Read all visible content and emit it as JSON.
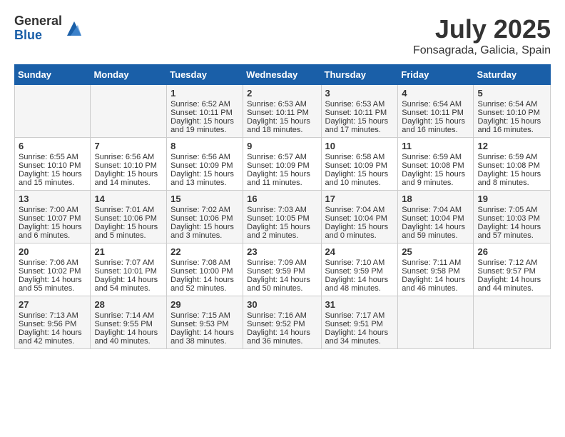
{
  "header": {
    "logo_general": "General",
    "logo_blue": "Blue",
    "month_title": "July 2025",
    "location": "Fonsagrada, Galicia, Spain"
  },
  "weekdays": [
    "Sunday",
    "Monday",
    "Tuesday",
    "Wednesday",
    "Thursday",
    "Friday",
    "Saturday"
  ],
  "weeks": [
    [
      {
        "day": "",
        "info": ""
      },
      {
        "day": "",
        "info": ""
      },
      {
        "day": "1",
        "info": "Sunrise: 6:52 AM\nSunset: 10:11 PM\nDaylight: 15 hours and 19 minutes."
      },
      {
        "day": "2",
        "info": "Sunrise: 6:53 AM\nSunset: 10:11 PM\nDaylight: 15 hours and 18 minutes."
      },
      {
        "day": "3",
        "info": "Sunrise: 6:53 AM\nSunset: 10:11 PM\nDaylight: 15 hours and 17 minutes."
      },
      {
        "day": "4",
        "info": "Sunrise: 6:54 AM\nSunset: 10:11 PM\nDaylight: 15 hours and 16 minutes."
      },
      {
        "day": "5",
        "info": "Sunrise: 6:54 AM\nSunset: 10:10 PM\nDaylight: 15 hours and 16 minutes."
      }
    ],
    [
      {
        "day": "6",
        "info": "Sunrise: 6:55 AM\nSunset: 10:10 PM\nDaylight: 15 hours and 15 minutes."
      },
      {
        "day": "7",
        "info": "Sunrise: 6:56 AM\nSunset: 10:10 PM\nDaylight: 15 hours and 14 minutes."
      },
      {
        "day": "8",
        "info": "Sunrise: 6:56 AM\nSunset: 10:09 PM\nDaylight: 15 hours and 13 minutes."
      },
      {
        "day": "9",
        "info": "Sunrise: 6:57 AM\nSunset: 10:09 PM\nDaylight: 15 hours and 11 minutes."
      },
      {
        "day": "10",
        "info": "Sunrise: 6:58 AM\nSunset: 10:09 PM\nDaylight: 15 hours and 10 minutes."
      },
      {
        "day": "11",
        "info": "Sunrise: 6:59 AM\nSunset: 10:08 PM\nDaylight: 15 hours and 9 minutes."
      },
      {
        "day": "12",
        "info": "Sunrise: 6:59 AM\nSunset: 10:08 PM\nDaylight: 15 hours and 8 minutes."
      }
    ],
    [
      {
        "day": "13",
        "info": "Sunrise: 7:00 AM\nSunset: 10:07 PM\nDaylight: 15 hours and 6 minutes."
      },
      {
        "day": "14",
        "info": "Sunrise: 7:01 AM\nSunset: 10:06 PM\nDaylight: 15 hours and 5 minutes."
      },
      {
        "day": "15",
        "info": "Sunrise: 7:02 AM\nSunset: 10:06 PM\nDaylight: 15 hours and 3 minutes."
      },
      {
        "day": "16",
        "info": "Sunrise: 7:03 AM\nSunset: 10:05 PM\nDaylight: 15 hours and 2 minutes."
      },
      {
        "day": "17",
        "info": "Sunrise: 7:04 AM\nSunset: 10:04 PM\nDaylight: 15 hours and 0 minutes."
      },
      {
        "day": "18",
        "info": "Sunrise: 7:04 AM\nSunset: 10:04 PM\nDaylight: 14 hours and 59 minutes."
      },
      {
        "day": "19",
        "info": "Sunrise: 7:05 AM\nSunset: 10:03 PM\nDaylight: 14 hours and 57 minutes."
      }
    ],
    [
      {
        "day": "20",
        "info": "Sunrise: 7:06 AM\nSunset: 10:02 PM\nDaylight: 14 hours and 55 minutes."
      },
      {
        "day": "21",
        "info": "Sunrise: 7:07 AM\nSunset: 10:01 PM\nDaylight: 14 hours and 54 minutes."
      },
      {
        "day": "22",
        "info": "Sunrise: 7:08 AM\nSunset: 10:00 PM\nDaylight: 14 hours and 52 minutes."
      },
      {
        "day": "23",
        "info": "Sunrise: 7:09 AM\nSunset: 9:59 PM\nDaylight: 14 hours and 50 minutes."
      },
      {
        "day": "24",
        "info": "Sunrise: 7:10 AM\nSunset: 9:59 PM\nDaylight: 14 hours and 48 minutes."
      },
      {
        "day": "25",
        "info": "Sunrise: 7:11 AM\nSunset: 9:58 PM\nDaylight: 14 hours and 46 minutes."
      },
      {
        "day": "26",
        "info": "Sunrise: 7:12 AM\nSunset: 9:57 PM\nDaylight: 14 hours and 44 minutes."
      }
    ],
    [
      {
        "day": "27",
        "info": "Sunrise: 7:13 AM\nSunset: 9:56 PM\nDaylight: 14 hours and 42 minutes."
      },
      {
        "day": "28",
        "info": "Sunrise: 7:14 AM\nSunset: 9:55 PM\nDaylight: 14 hours and 40 minutes."
      },
      {
        "day": "29",
        "info": "Sunrise: 7:15 AM\nSunset: 9:53 PM\nDaylight: 14 hours and 38 minutes."
      },
      {
        "day": "30",
        "info": "Sunrise: 7:16 AM\nSunset: 9:52 PM\nDaylight: 14 hours and 36 minutes."
      },
      {
        "day": "31",
        "info": "Sunrise: 7:17 AM\nSunset: 9:51 PM\nDaylight: 14 hours and 34 minutes."
      },
      {
        "day": "",
        "info": ""
      },
      {
        "day": "",
        "info": ""
      }
    ]
  ]
}
